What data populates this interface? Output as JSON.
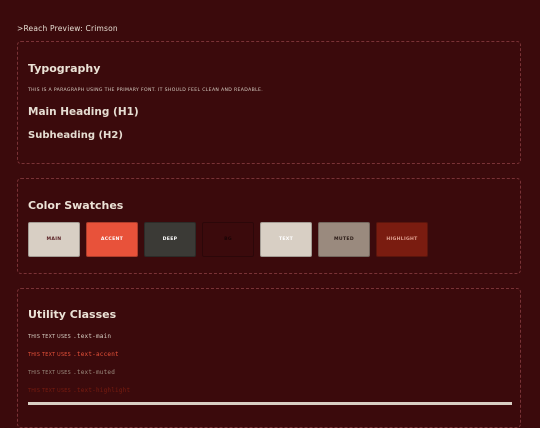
{
  "page": {
    "title": ">Reach Preview: Crimson"
  },
  "typography": {
    "title": "Typography",
    "paragraph": "This is a paragraph using the primary font. It should feel clean and readable.",
    "heading1": "Main Heading (H1)",
    "heading2": "Subheading (H2)"
  },
  "swatches": {
    "title": "Color Swatches",
    "items": [
      {
        "label": "Main",
        "bg": "#d8cfc4",
        "fg": "#5a2226"
      },
      {
        "label": "Accent",
        "bg": "#e8523a",
        "fg": "#ffffff"
      },
      {
        "label": "Deep",
        "bg": "#3b3a36",
        "fg": "#ffffff"
      },
      {
        "label": "BG",
        "bg": "#3b0a0c",
        "fg": "#1a0405"
      },
      {
        "label": "Text",
        "bg": "#d8cfc4",
        "fg": "#ffffff"
      },
      {
        "label": "Muted",
        "bg": "#9a8a7e",
        "fg": "#2a1a16"
      },
      {
        "label": "Highlight",
        "bg": "#7a1c10",
        "fg": "#e0a090"
      }
    ]
  },
  "utility": {
    "title": "Utility Classes",
    "prefix": "This text uses",
    "lines": [
      {
        "cls": ".text-main",
        "color": "#d8cfc4"
      },
      {
        "cls": ".text-accent",
        "color": "#e8523a"
      },
      {
        "cls": ".text-muted",
        "color": "#9a8a7e"
      },
      {
        "cls": ".text-highlight",
        "color": "#7a1c10"
      }
    ]
  }
}
